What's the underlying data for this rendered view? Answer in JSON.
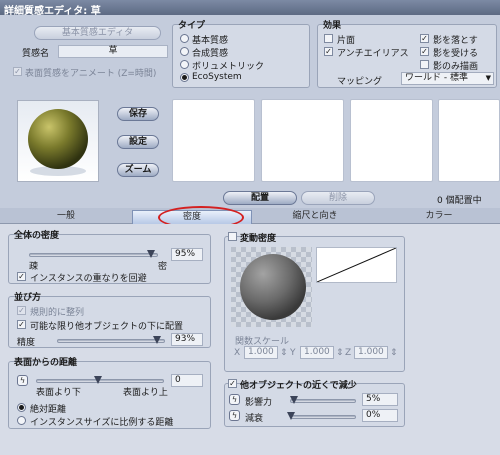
{
  "window": {
    "title": "詳細質感エディタ: 草"
  },
  "material": {
    "basic_editor_button": "基本質感エディタ",
    "name_label": "質感名",
    "name_value": "草",
    "animate_label": "表面質感をアニメート (Z=時間)"
  },
  "type_group": {
    "title": "タイプ",
    "options": [
      "基本質感",
      "合成質感",
      "ボリュメトリック",
      "EcoSystem"
    ],
    "selected": "EcoSystem"
  },
  "effects_group": {
    "title": "効果",
    "left": [
      {
        "label": "片面",
        "checked": false
      },
      {
        "label": "アンチエイリアス",
        "checked": true
      }
    ],
    "right": [
      {
        "label": "影を落とす",
        "checked": true
      },
      {
        "label": "影を受ける",
        "checked": true
      },
      {
        "label": "影のみ描画",
        "checked": false
      }
    ],
    "mapping_label": "マッピング",
    "mapping_value": "ワールド - 標準"
  },
  "side_buttons": {
    "save": "保存",
    "settings": "設定",
    "zoom": "ズーム"
  },
  "placement": {
    "place_button": "配置",
    "delete_button": "削除",
    "status": "0 個配置中"
  },
  "tabs": [
    {
      "label": "一般",
      "active": false
    },
    {
      "label": "密度",
      "active": true
    },
    {
      "label": "縮尺と向き",
      "active": false
    },
    {
      "label": "カラー",
      "active": false
    }
  ],
  "density": {
    "title": "全体の密度",
    "min_label": "疎",
    "max_label": "密",
    "value": "95%",
    "level": 0.95,
    "avoid_overlap_label": "インスタンスの重なりを回避"
  },
  "arrangement": {
    "title": "並び方",
    "regular_label": "規則的に整列",
    "under_others_label": "可能な限り他オブジェクトの下に配置",
    "precision_label": "精度",
    "precision_value": "93%",
    "precision_level": 0.93
  },
  "surface_distance": {
    "title": "表面からの距離",
    "below_label": "表面より下",
    "above_label": "表面より上",
    "value": "0",
    "absolute_label": "絶対距離",
    "proportional_label": "インスタンスサイズに比例する距離"
  },
  "variable_density": {
    "title": "変動密度",
    "func_scale_label": "関数スケール",
    "x_label": "X",
    "x_value": "1.000",
    "y_label": "Y",
    "y_value": "1.000",
    "z_label": "Z",
    "z_value": "1.000"
  },
  "reduce_near": {
    "title": "他オブジェクトの近くで減少",
    "influence_label": "影響力",
    "influence_value": "5%",
    "influence_level": 0.05,
    "decay_label": "減衰",
    "decay_value": "0%",
    "decay_level": 0.0
  },
  "colors": {
    "highlight_ring": "#d42020",
    "title_bar": "#6b7891"
  }
}
